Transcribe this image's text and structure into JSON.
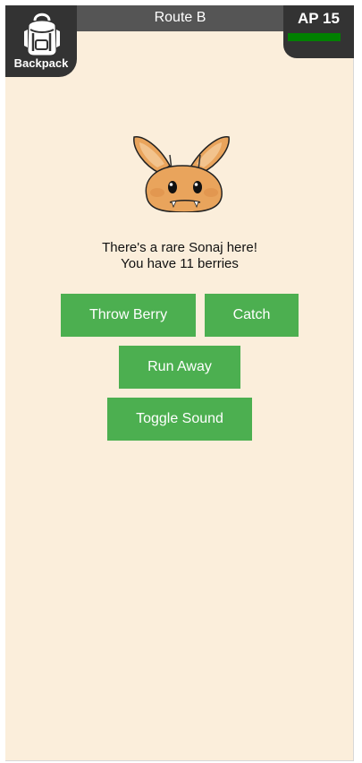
{
  "header": {
    "route_name": "Route B",
    "backpack_label": "Backpack",
    "ap_label": "AP 15",
    "ap_fraction": 1.0
  },
  "encounter": {
    "creature_icon": "sonaj-creature-icon",
    "message_line1": "There's a rare Sonaj here!",
    "message_line2": "You have 11 berries"
  },
  "actions": {
    "throw_berry": "Throw Berry",
    "catch": "Catch",
    "run_away": "Run Away",
    "toggle_sound": "Toggle Sound"
  },
  "colors": {
    "background": "#fbeedb",
    "panel": "#333333",
    "route_bar": "#555555",
    "button": "#4caf50",
    "ap_bar": "#008000"
  }
}
